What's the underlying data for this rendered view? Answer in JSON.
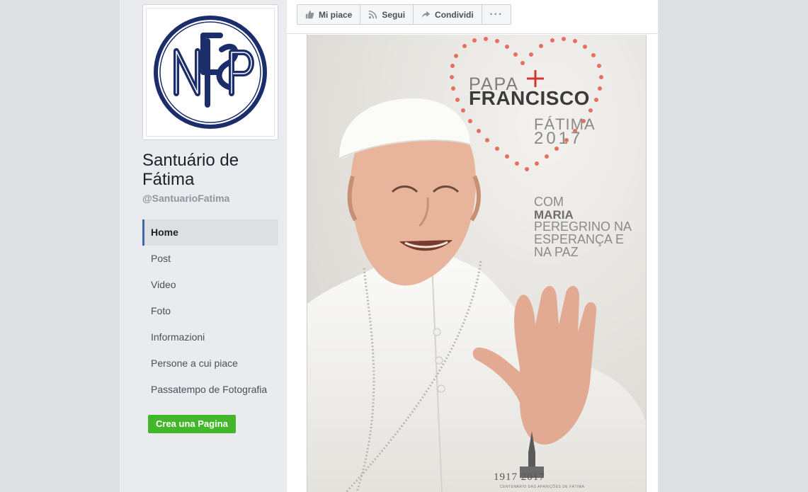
{
  "page": {
    "name": "Santuário de Fátima",
    "handle": "@SantuarioFatima"
  },
  "nav": {
    "items": [
      {
        "label": "Home",
        "active": true
      },
      {
        "label": "Post",
        "active": false
      },
      {
        "label": "Video",
        "active": false
      },
      {
        "label": "Foto",
        "active": false
      },
      {
        "label": "Informazioni",
        "active": false
      },
      {
        "label": "Persone a cui piace",
        "active": false
      },
      {
        "label": "Passatempo de Fotografia",
        "active": false
      }
    ]
  },
  "create_page_label": "Crea una Pagina",
  "actions": {
    "like": "Mi piace",
    "follow": "Segui",
    "share": "Condividi",
    "more": "···"
  },
  "cover": {
    "papa": "PAPA",
    "francisco": "FRANCISCO",
    "fatima": "FÁTIMA",
    "year": "2017",
    "com": "COM",
    "maria": "MARIA",
    "peregrino": "PEREGRINO NA",
    "esperanca": "ESPERANÇA E",
    "na_paz": "NA PAZ",
    "centenary": "1917 2017",
    "centenary_sub": "CENTENÁRIO DAS APARIÇÕES DE FÁTIMA"
  },
  "colors": {
    "accent": "#4267b2",
    "create_button": "#42b72a",
    "logo_navy": "#1b2e6b",
    "heart_dots": "#e6705d",
    "cross_red": "#d2352f"
  },
  "icons": {
    "like": "thumbs-up-icon",
    "follow": "rss-icon",
    "share": "share-arrow-icon",
    "more": "ellipsis-icon"
  }
}
